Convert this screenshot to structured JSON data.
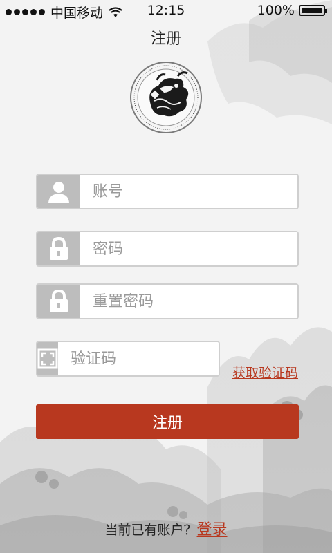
{
  "status_bar": {
    "carrier": "中国移动",
    "time": "12:15",
    "battery": "100%",
    "battery_level": 1.0,
    "icons": [
      "signal-dots-icon",
      "wifi-icon",
      "battery-icon"
    ]
  },
  "header": {
    "title": "注册"
  },
  "logo": {
    "icon": "qilin-emblem-icon"
  },
  "form": {
    "account": {
      "placeholder": "账号",
      "value": "",
      "icon": "user-icon"
    },
    "password": {
      "placeholder": "密码",
      "value": "",
      "icon": "lock-icon"
    },
    "reset_password": {
      "placeholder": "重置密码",
      "value": "",
      "icon": "lock-icon"
    },
    "verification": {
      "placeholder": "验证码",
      "value": "",
      "icon": "captcha-frame-icon"
    },
    "get_code_label": "获取验证码",
    "submit_label": "注册"
  },
  "footer": {
    "prompt": "当前已有账户？",
    "login_label": "登录"
  },
  "colors": {
    "accent": "#b8381f",
    "icon_box": "#bdbdbd",
    "background": "#f3f3f3"
  }
}
